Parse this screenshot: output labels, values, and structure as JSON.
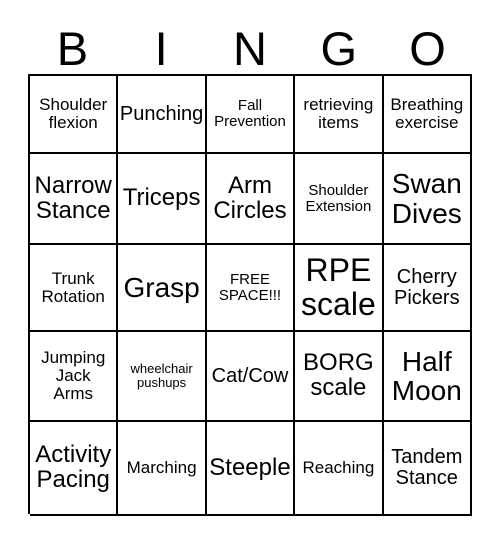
{
  "card": {
    "header_letters": [
      "B",
      "I",
      "N",
      "G",
      "O"
    ],
    "grid": {
      "columns": 5,
      "rows": 5,
      "cells": [
        {
          "text": "Shoulder\nflexion",
          "size": "md"
        },
        {
          "text": "Punching",
          "size": "lg"
        },
        {
          "text": "Fall\nPrevention",
          "size": "sm"
        },
        {
          "text": "retrieving\nitems",
          "size": "md"
        },
        {
          "text": "Breathing\nexercise",
          "size": "md"
        },
        {
          "text": "Narrow\nStance",
          "size": "xl"
        },
        {
          "text": "Triceps",
          "size": "xl"
        },
        {
          "text": "Arm\nCircles",
          "size": "xl"
        },
        {
          "text": "Shoulder\nExtension",
          "size": "sm"
        },
        {
          "text": "Swan\nDives",
          "size": "xxl"
        },
        {
          "text": "Trunk\nRotation",
          "size": "md"
        },
        {
          "text": "Grasp",
          "size": "xxl"
        },
        {
          "text": "FREE\nSPACE!!!",
          "size": "sm"
        },
        {
          "text": "RPE\nscale",
          "size": "huge"
        },
        {
          "text": "Cherry\nPickers",
          "size": "lg"
        },
        {
          "text": "Jumping\nJack\nArms",
          "size": "md"
        },
        {
          "text": "wheelchair\npushups",
          "size": "xs"
        },
        {
          "text": "Cat/Cow",
          "size": "lg"
        },
        {
          "text": "BORG\nscale",
          "size": "xl"
        },
        {
          "text": "Half\nMoon",
          "size": "xxl"
        },
        {
          "text": "Activity\nPacing",
          "size": "xl"
        },
        {
          "text": "Marching",
          "size": "md"
        },
        {
          "text": "Steeple",
          "size": "xl"
        },
        {
          "text": "Reaching",
          "size": "md"
        },
        {
          "text": "Tandem\nStance",
          "size": "lg"
        }
      ]
    }
  },
  "colors": {
    "background": "#ffffff",
    "grid_line": "#000000",
    "text": "#000000"
  }
}
